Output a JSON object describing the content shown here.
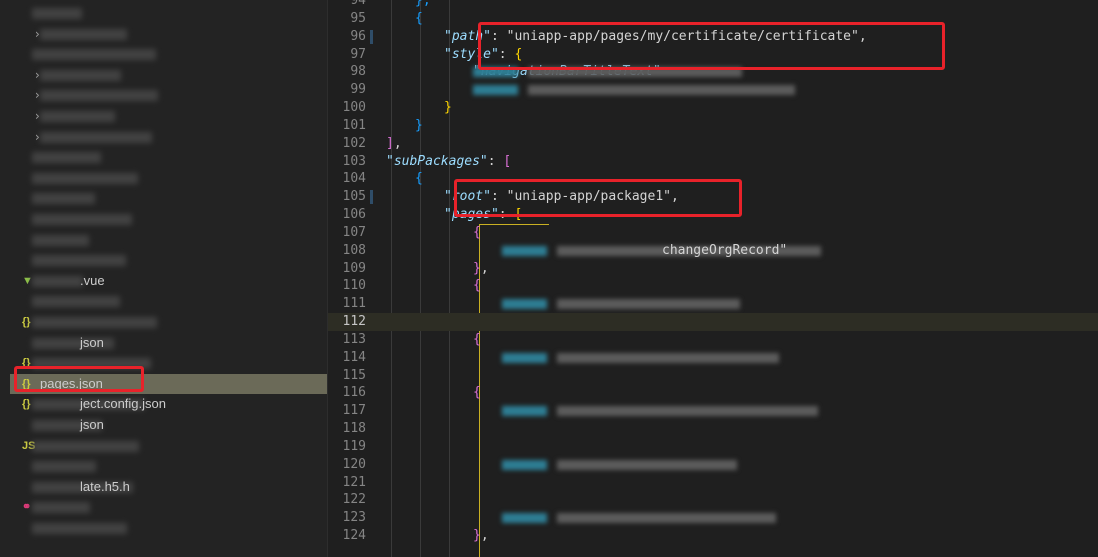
{
  "sidebar": {
    "items": [
      {
        "icon": "",
        "label": "",
        "blur": true
      },
      {
        "icon": "chevron",
        "label": "",
        "blur": true
      },
      {
        "icon": "",
        "label": "",
        "blur": true
      },
      {
        "icon": "chevron",
        "label": "",
        "blur": true
      },
      {
        "icon": "chevron",
        "label": "",
        "blur": true
      },
      {
        "icon": "chevron",
        "label": "",
        "blur": true
      },
      {
        "icon": "chevron",
        "label": "",
        "blur": true
      },
      {
        "icon": "",
        "label": "",
        "blur": true
      },
      {
        "icon": "",
        "label": "",
        "blur": true
      },
      {
        "icon": "",
        "label": "",
        "blur": true
      },
      {
        "icon": "",
        "label": "",
        "blur": true
      },
      {
        "icon": "",
        "label": "",
        "blur": true
      },
      {
        "icon": "",
        "label": "",
        "blur": true
      },
      {
        "icon": "vue",
        "label": ".vue",
        "blur": true
      },
      {
        "icon": "",
        "label": "",
        "blur": true
      },
      {
        "icon": "json",
        "label": "",
        "blur": true
      },
      {
        "icon": "",
        "label": "json",
        "blur": true
      },
      {
        "icon": "json",
        "label": "",
        "blur": true
      },
      {
        "icon": "json",
        "label": "pages.json",
        "blur": false,
        "selected": true
      },
      {
        "icon": "json",
        "label": "ject.config.json",
        "blur": true
      },
      {
        "icon": "",
        "label": "json",
        "blur": true
      },
      {
        "icon": "js",
        "label": "",
        "blur": true
      },
      {
        "icon": "",
        "label": "",
        "blur": true
      },
      {
        "icon": "",
        "label": "late.h5.h",
        "blur": true
      },
      {
        "icon": "git",
        "label": "",
        "blur": true
      },
      {
        "icon": "",
        "label": "",
        "blur": true
      }
    ]
  },
  "icons": {
    "json": "{}",
    "js": "JS",
    "vue": "▼",
    "git": "⚭",
    "chevron": "›"
  },
  "colors": {
    "highlight_box": "#e8222a",
    "selected_row": "#6b6a58",
    "key": "#9cdcfe"
  },
  "editor": {
    "current_line": 112,
    "lines": [
      {
        "n": 94,
        "i": 2,
        "s": [
          [
            "},",
            "b1"
          ]
        ]
      },
      {
        "n": 95,
        "i": 2,
        "s": [
          [
            "{",
            "b1"
          ]
        ]
      },
      {
        "n": 96,
        "i": 3,
        "s": [
          [
            "\"path\"",
            "key"
          ],
          [
            ": ",
            "p"
          ],
          [
            "\"uniapp-app/pages/my/certificate/certificate\"",
            "str"
          ],
          [
            ",",
            "p"
          ]
        ]
      },
      {
        "n": 97,
        "i": 3,
        "s": [
          [
            "\"style\"",
            "key"
          ],
          [
            ": ",
            "p"
          ],
          [
            "{",
            "b2"
          ]
        ]
      },
      {
        "n": 98,
        "i": 4,
        "s": [
          [
            "\"navigationBarTitleText\"",
            "key"
          ]
        ],
        "blur": true
      },
      {
        "n": 99,
        "i": 4,
        "s": [],
        "blur": true
      },
      {
        "n": 100,
        "i": 3,
        "s": [
          [
            "}",
            "b2"
          ]
        ]
      },
      {
        "n": 101,
        "i": 2,
        "s": [
          [
            "}",
            "b1"
          ]
        ]
      },
      {
        "n": 102,
        "i": 1,
        "s": [
          [
            "]",
            "b3"
          ],
          [
            ",",
            "p"
          ]
        ]
      },
      {
        "n": 103,
        "i": 1,
        "s": [
          [
            "\"subPackages\"",
            "key"
          ],
          [
            ": ",
            "p"
          ],
          [
            "[",
            "b3"
          ]
        ]
      },
      {
        "n": 104,
        "i": 2,
        "s": [
          [
            "{",
            "b1"
          ]
        ]
      },
      {
        "n": 105,
        "i": 3,
        "s": [
          [
            "\"root\"",
            "key"
          ],
          [
            ": ",
            "p"
          ],
          [
            "\"uniapp-app/package1\"",
            "str"
          ],
          [
            ",",
            "p"
          ]
        ]
      },
      {
        "n": 106,
        "i": 3,
        "s": [
          [
            "\"pages\"",
            "key"
          ],
          [
            ": ",
            "p"
          ],
          [
            "[",
            "b2"
          ]
        ]
      },
      {
        "n": 107,
        "i": 4,
        "s": [
          [
            "{",
            "b3"
          ]
        ]
      },
      {
        "n": 108,
        "i": 5,
        "s": [
          [
            "changeOrgRecord\"",
            "str"
          ]
        ],
        "blur": true
      },
      {
        "n": 109,
        "i": 4,
        "s": [
          [
            "}",
            "b3"
          ],
          [
            ",",
            "p"
          ]
        ]
      },
      {
        "n": 110,
        "i": 4,
        "s": [
          [
            "{",
            "b3"
          ]
        ]
      },
      {
        "n": 111,
        "i": 5,
        "s": [],
        "blur": true
      },
      {
        "n": 112,
        "i": 4,
        "s": []
      },
      {
        "n": 113,
        "i": 4,
        "s": [
          [
            "{",
            "b3"
          ]
        ]
      },
      {
        "n": 114,
        "i": 5,
        "s": [],
        "blur": true
      },
      {
        "n": 115,
        "i": 4,
        "s": []
      },
      {
        "n": 116,
        "i": 4,
        "s": [
          [
            "{",
            "b3"
          ]
        ]
      },
      {
        "n": 117,
        "i": 5,
        "s": [],
        "blur": true
      },
      {
        "n": 118,
        "i": 4,
        "s": []
      },
      {
        "n": 119,
        "i": 4,
        "s": []
      },
      {
        "n": 120,
        "i": 5,
        "s": [],
        "blur": true
      },
      {
        "n": 121,
        "i": 4,
        "s": []
      },
      {
        "n": 122,
        "i": 4,
        "s": []
      },
      {
        "n": 123,
        "i": 5,
        "s": [],
        "blur": true
      },
      {
        "n": 124,
        "i": 4,
        "s": [
          [
            "}",
            "b3"
          ],
          [
            ",",
            "p"
          ]
        ]
      }
    ]
  }
}
